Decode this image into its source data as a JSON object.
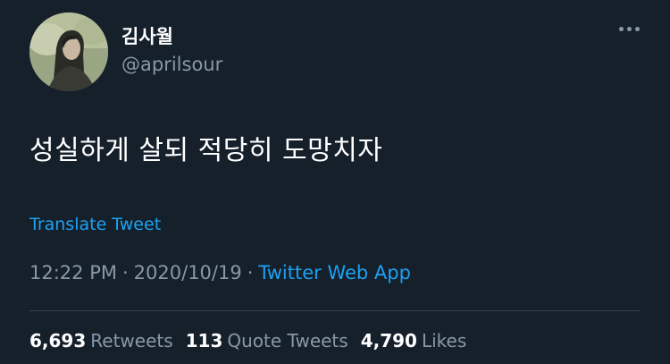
{
  "author": {
    "display_name": "김사월",
    "handle": "@aprilsour"
  },
  "menu": {
    "icon": "more-horizontal-icon"
  },
  "tweet": {
    "text": "성실하게 살되 적당히 도망치자",
    "translate_label": "Translate Tweet"
  },
  "meta": {
    "time": "12:22 PM",
    "separator": "·",
    "date": "2020/10/19",
    "source": "Twitter Web App"
  },
  "stats": {
    "retweets_count": "6,693",
    "retweets_label": "Retweets",
    "quote_count": "113",
    "quote_label": "Quote Tweets",
    "likes_count": "4,790",
    "likes_label": "Likes"
  },
  "colors": {
    "background": "#15202b",
    "link": "#1da1f2",
    "secondary_text": "#8899a6",
    "divider": "#38444d"
  }
}
